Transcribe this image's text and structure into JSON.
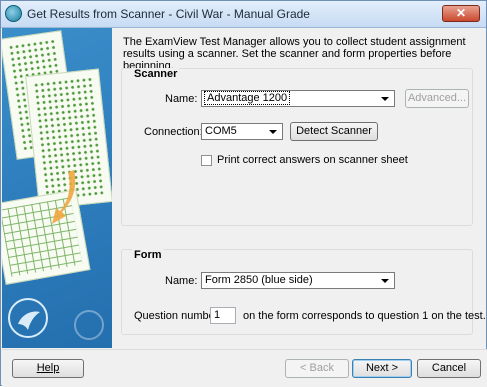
{
  "window": {
    "title": "Get Results from Scanner - Civil War - Manual Grade",
    "close_label": "✕"
  },
  "intro_text": "The ExamView Test Manager allows you to collect student assignment results using a scanner. Set the scanner and form properties before beginning.",
  "scanner": {
    "group_title": "Scanner",
    "name_label": "Name:",
    "name_value": "Advantage 1200",
    "advanced_label": "Advanced...",
    "connection_label": "Connection:",
    "connection_value": "COM5",
    "detect_label": "Detect Scanner",
    "print_checkbox_label": "Print correct answers on scanner sheet",
    "print_checked": false
  },
  "form": {
    "group_title": "Form",
    "name_label": "Name:",
    "name_value": "Form 2850 (blue side)",
    "question_label": "Question number",
    "question_value": "1",
    "question_suffix": "on the form corresponds to question 1 on the test."
  },
  "footer": {
    "help_label": "Help",
    "back_label": "< Back",
    "next_label": "Next >",
    "cancel_label": "Cancel"
  },
  "icons": {
    "app": "app-icon",
    "dropdown": "chevron-down-icon",
    "close": "close-icon"
  },
  "colors": {
    "side_panel": "#2f7fbf",
    "close_button": "#c94a2f",
    "default_button_border": "#3c7fb1"
  }
}
